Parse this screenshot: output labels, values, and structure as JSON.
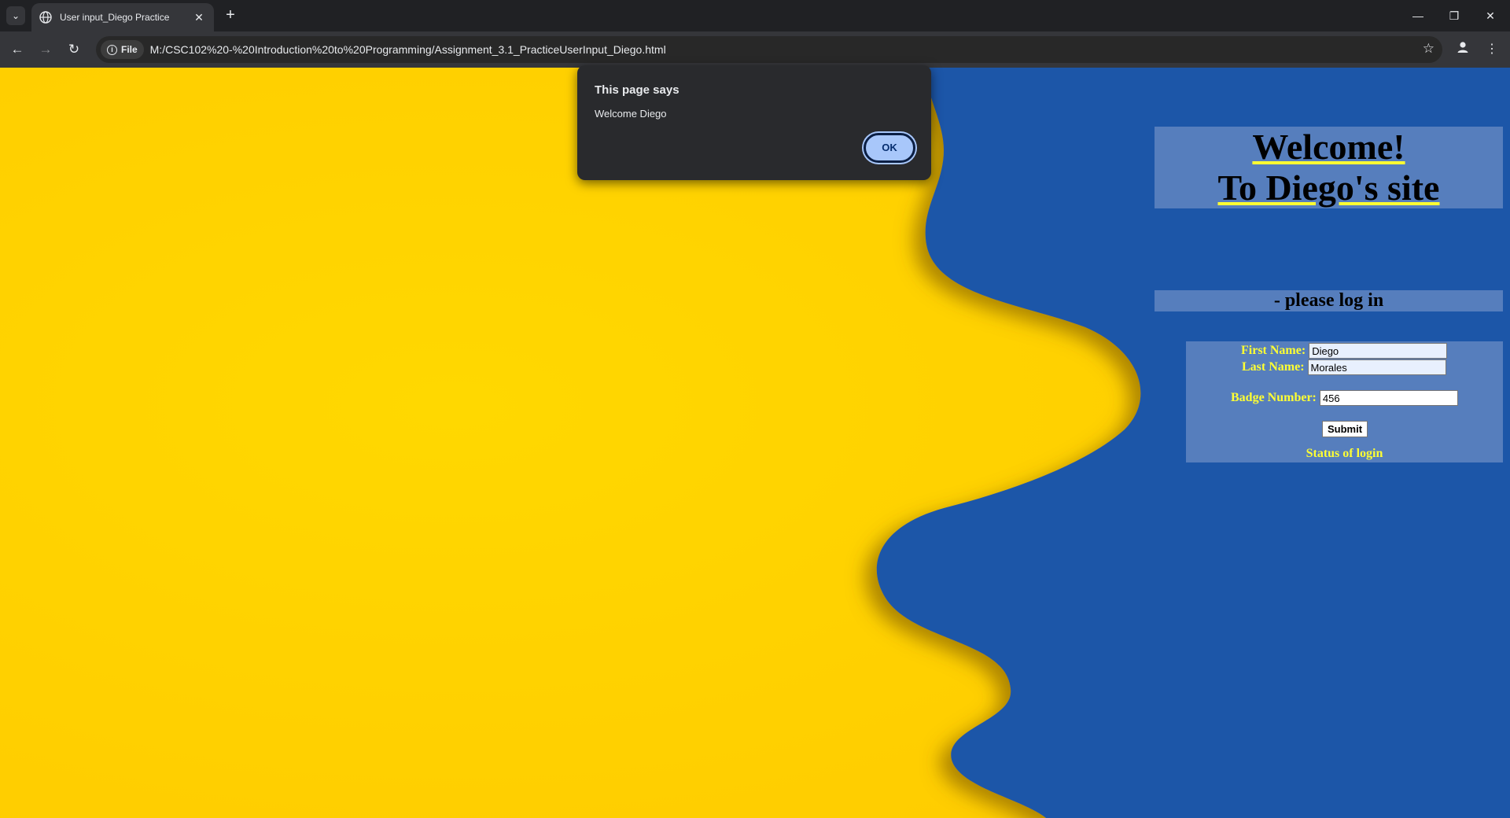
{
  "browser": {
    "tab_title": "User input_Diego Practice",
    "new_tab_symbol": "+",
    "address_chip": "File",
    "url": "M:/CSC102%20-%20Introduction%20to%20Programming/Assignment_3.1_PracticeUserInput_Diego.html"
  },
  "page": {
    "welcome_line1": "Welcome!",
    "welcome_line2": "To Diego's site",
    "login_heading": "- please log in",
    "form": {
      "first_name_label": "First Name:",
      "first_name_value": "Diego",
      "last_name_label": "Last Name:",
      "last_name_value": "Morales",
      "badge_label": "Badge Number:",
      "badge_value": "456",
      "submit_label": "Submit"
    },
    "status": "Status of login"
  },
  "dialog": {
    "title": "This page says",
    "message": "Welcome Diego",
    "ok_label": "OK"
  },
  "colors": {
    "background_yellow": "#ffd600",
    "background_blue": "#1f57a8",
    "form_text_yellow": "#ffff33",
    "dialog_bg": "#292a2d",
    "ok_button": "#a8c7fa"
  }
}
